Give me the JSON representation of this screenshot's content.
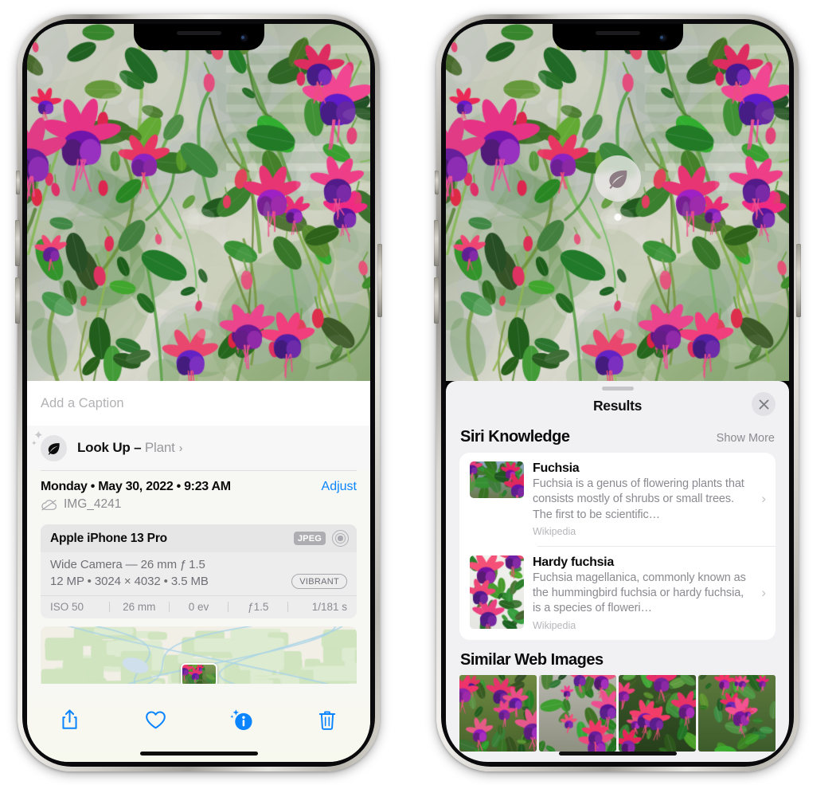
{
  "left_phone": {
    "name": "photo-detail-screen",
    "caption_placeholder": "Add a Caption",
    "lookup": {
      "label": "Look Up – ",
      "subject": "Plant",
      "chevron": "›",
      "icon": "leaf-icon"
    },
    "meta": {
      "date": "Monday • May 30, 2022 • 9:23 AM",
      "adjust_label": "Adjust",
      "filename": "IMG_4241",
      "cloud_icon": "cloud-slash-icon"
    },
    "exif": {
      "device": "Apple iPhone 13 Pro",
      "format_badge": "JPEG",
      "lens_icon": "aperture-icon",
      "line1": "Wide Camera — 26 mm ƒ 1.5",
      "line2": "12 MP • 3024 × 4032 • 3.5 MB",
      "profile_badge": "VIBRANT",
      "stats": [
        "ISO 50",
        "26 mm",
        "0 ev",
        "ƒ1.5",
        "1/181 s"
      ]
    },
    "toolbar": [
      {
        "name": "share-button",
        "icon": "share-icon"
      },
      {
        "name": "favorite-button",
        "icon": "heart-icon"
      },
      {
        "name": "info-button",
        "icon": "info-sparkle-icon"
      },
      {
        "name": "delete-button",
        "icon": "trash-icon"
      }
    ]
  },
  "right_phone": {
    "name": "visual-lookup-results-screen",
    "leaf_badge_icon": "leaf-icon",
    "sheet": {
      "title": "Results",
      "close_icon": "close-icon",
      "siri_knowledge": {
        "heading": "Siri Knowledge",
        "show_more": "Show More",
        "items": [
          {
            "title": "Fuchsia",
            "description": "Fuchsia is a genus of flowering plants that consists mostly of shrubs or small trees. The first to be scientific…",
            "source": "Wikipedia",
            "chevron": "›"
          },
          {
            "title": "Hardy fuchsia",
            "description": "Fuchsia magellanica, commonly known as the hummingbird fuchsia or hardy fuchsia, is a species of floweri…",
            "source": "Wikipedia",
            "chevron": "›"
          }
        ]
      },
      "similar_web_images": {
        "heading": "Similar Web Images",
        "count": 4
      }
    }
  },
  "colors": {
    "accent_blue": "#0b84ff",
    "sheet_bg": "#f1f1f4",
    "card_bg": "#ffffff",
    "secondary_text": "#8a8a90",
    "badge_gray": "#adadb2"
  }
}
